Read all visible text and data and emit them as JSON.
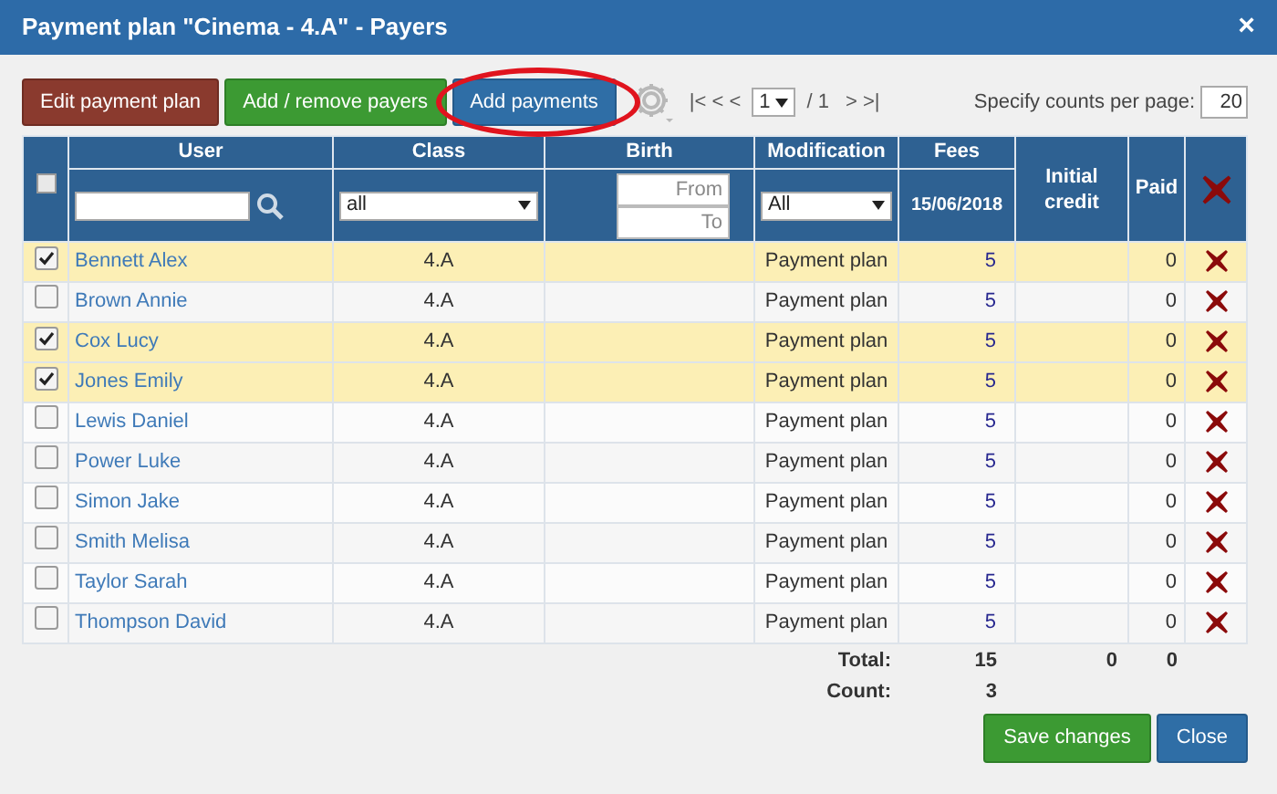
{
  "window": {
    "title": "Payment plan \"Cinema - 4.A\" - Payers",
    "close": "×"
  },
  "toolbar": {
    "buttons": [
      {
        "label": "Edit payment plan",
        "kind": "brown",
        "highlighted": false
      },
      {
        "label": "Add / remove payers",
        "kind": "green",
        "highlighted": false
      },
      {
        "label": "Add payments",
        "kind": "blue",
        "highlighted": true
      }
    ],
    "pager": {
      "back": "|< < <",
      "page": "1",
      "of": "/ 1",
      "forward": "> >|",
      "per_page_label": "Specify counts per page:",
      "per_page": "20"
    }
  },
  "table": {
    "columns": {
      "user": "User",
      "class": "Class",
      "birth": "Birth",
      "modification": "Modification",
      "fees": "Fees",
      "fees_date": "15/06/2018",
      "initial_credit": "Initial credit",
      "paid": "Paid"
    },
    "filters": {
      "select_all_checked": false,
      "class": "all",
      "birth_from": {
        "placeholder": "From"
      },
      "birth_to": {
        "placeholder": "To"
      },
      "modification": "All"
    },
    "rows": [
      {
        "user": "Bennett Alex",
        "class": "4.A",
        "modification": "Payment plan",
        "fees": "5",
        "paid": "0",
        "selected": true
      },
      {
        "user": "Brown Annie",
        "class": "4.A",
        "modification": "Payment plan",
        "fees": "5",
        "paid": "0",
        "selected": false
      },
      {
        "user": "Cox Lucy",
        "class": "4.A",
        "modification": "Payment plan",
        "fees": "5",
        "paid": "0",
        "selected": true
      },
      {
        "user": "Jones Emily",
        "class": "4.A",
        "modification": "Payment plan",
        "fees": "5",
        "paid": "0",
        "selected": true
      },
      {
        "user": "Lewis Daniel",
        "class": "4.A",
        "modification": "Payment plan",
        "fees": "5",
        "paid": "0",
        "selected": false
      },
      {
        "user": "Power Luke",
        "class": "4.A",
        "modification": "Payment plan",
        "fees": "5",
        "paid": "0",
        "selected": false
      },
      {
        "user": "Simon Jake",
        "class": "4.A",
        "modification": "Payment plan",
        "fees": "5",
        "paid": "0",
        "selected": false
      },
      {
        "user": "Smith Melisa",
        "class": "4.A",
        "modification": "Payment plan",
        "fees": "5",
        "paid": "0",
        "selected": false
      },
      {
        "user": "Taylor Sarah",
        "class": "4.A",
        "modification": "Payment plan",
        "fees": "5",
        "paid": "0",
        "selected": false
      },
      {
        "user": "Thompson David",
        "class": "4.A",
        "modification": "Payment plan",
        "fees": "5",
        "paid": "0",
        "selected": false
      }
    ],
    "totals": {
      "total_label": "Total:",
      "fees": "15",
      "initial_credit": "0",
      "paid": "0",
      "count_label": "Count:",
      "count": "3"
    }
  },
  "footer": {
    "buttons": [
      {
        "label": "Save changes",
        "kind": "green"
      },
      {
        "label": "Close",
        "kind": "blue"
      }
    ]
  }
}
